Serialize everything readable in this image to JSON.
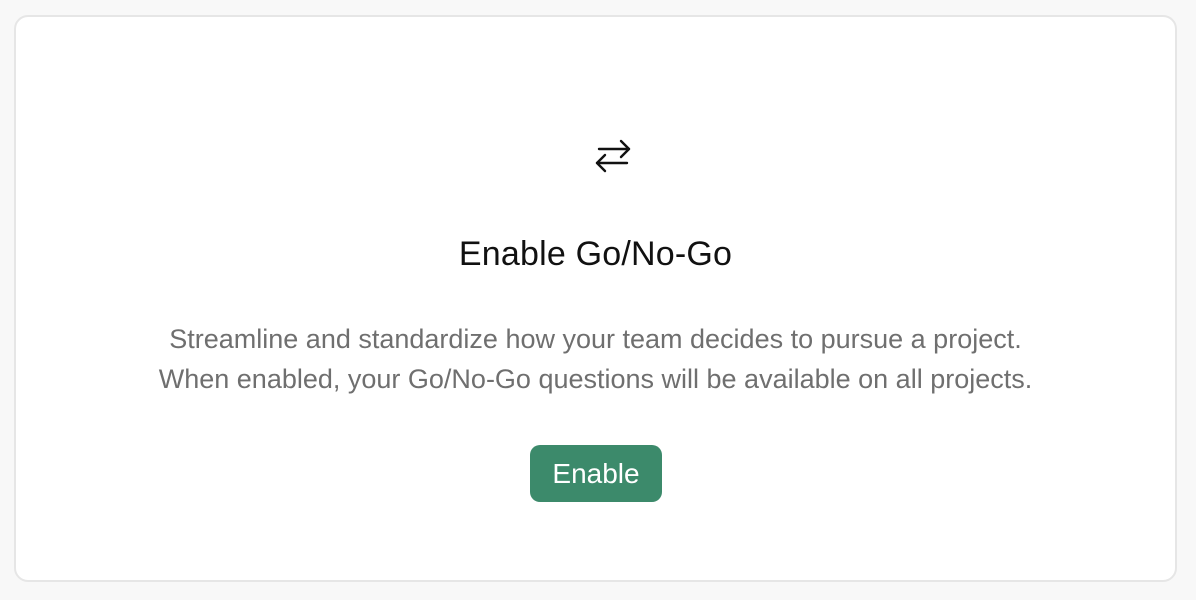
{
  "panel": {
    "icon": "arrows-left-right-icon",
    "title": "Enable Go/No-Go",
    "description_lines": [
      "Streamline and standardize how your team decides to pursue a project.",
      "When enabled, your Go/No-Go questions will be available on all projects."
    ],
    "button_label": "Enable"
  },
  "colors": {
    "accent": "#3c8a6b",
    "title": "#111111",
    "description": "#6f6f6f",
    "card_border": "#e6e6e6",
    "background": "#f8f8f8"
  }
}
